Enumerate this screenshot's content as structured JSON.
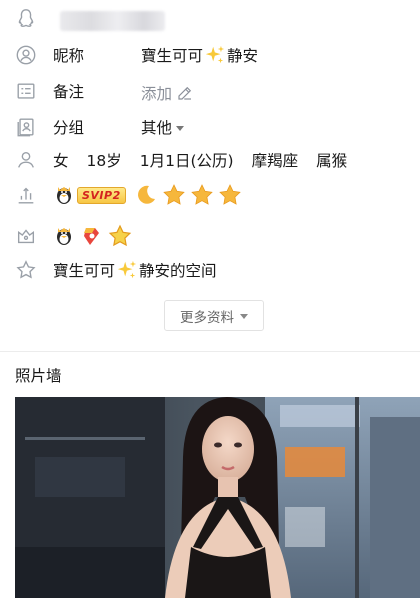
{
  "profile": {
    "qq_icon": "penguin-outline-icon",
    "nickname": {
      "icon": "user-circle-icon",
      "label": "昵称",
      "value_part1": "寶生可可",
      "value_part2": "静安",
      "sparkle_icon": "sparkles-emoji"
    },
    "remark": {
      "icon": "id-card-icon",
      "label": "备注",
      "value": "添加",
      "edit_icon": "pencil-icon"
    },
    "group": {
      "icon": "contact-card-icon",
      "label": "分组",
      "value": "其他"
    },
    "info": {
      "icon": "person-icon",
      "gender": "女",
      "age": "18岁",
      "birthday": "1月1日(公历)",
      "constellation": "摩羯座",
      "zodiac": "属猴"
    },
    "level": {
      "icon": "level-bars-icon",
      "svip_label": "SVIP2",
      "badges": [
        "moon-icon",
        "star-icon",
        "star-icon",
        "star-icon"
      ]
    },
    "medals": {
      "icon": "crown-outline-icon",
      "items": [
        "penguin-medal-icon",
        "red-badge-medal-icon",
        "star-medal-icon"
      ]
    },
    "space": {
      "icon": "star-outline-icon",
      "text_part1": "寶生可可",
      "text_part2": "静安的空间"
    },
    "more_button": "更多资料",
    "photo_wall_title": "照片墙"
  },
  "colors": {
    "icon_gray": "#9aa0a8",
    "link_gray": "#8a8f99",
    "star_gold": "#f6b73c",
    "svip_red": "#d4241f"
  }
}
